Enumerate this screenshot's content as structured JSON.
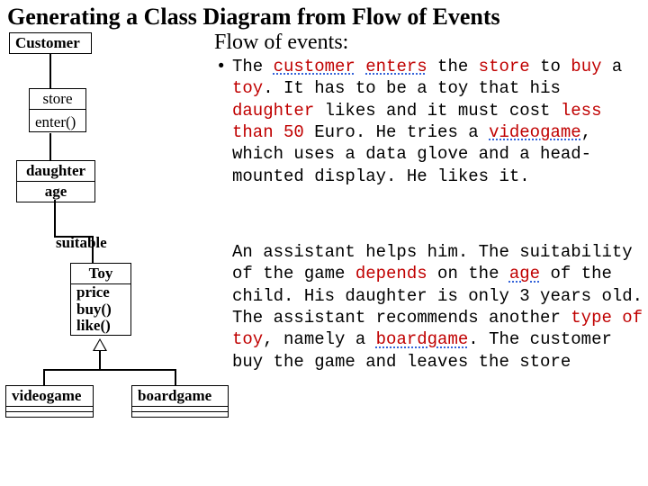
{
  "title": "Generating a Class Diagram from Flow of Events",
  "flow_header": "Flow of events:",
  "classes": {
    "customer": {
      "name": "Customer"
    },
    "store": {
      "name": "store",
      "ops": [
        "enter()"
      ]
    },
    "daughter": {
      "name": "daughter",
      "attrs": [
        "age"
      ]
    },
    "toy": {
      "name": "Toy",
      "attrs": [
        "price"
      ],
      "ops": [
        "buy()",
        "like()"
      ]
    },
    "videogame": {
      "name": "videogame"
    },
    "boardgame": {
      "name": "boardgame"
    }
  },
  "assoc_labels": {
    "customer_toy": "suitable"
  },
  "flow": {
    "p1_a": "The ",
    "p1_customer": "customer",
    "p1_b": " ",
    "p1_enters": "enters",
    "p1_c": " the ",
    "p1_store": "store",
    "p1_d": " to ",
    "p1_buy": "buy",
    "p1_e": " a ",
    "p1_toy": "toy",
    "p1_f": ". It has to be a toy that his ",
    "p1_daughter": "daughter",
    "p1_g": " likes and it must cost ",
    "p1_less": "less than 50",
    "p1_h": " Euro. He tries a ",
    "p1_videogame": "videogame",
    "p1_i": ", which uses a data glove and a head-mounted display. He likes it.",
    "p2_a": "An assistant helps him. The suitability of the game ",
    "p2_depends": "depends",
    "p2_b": " on the ",
    "p2_age": "age",
    "p2_c": " of the child. His daughter is only 3 years old. The assistant recommends another ",
    "p2_type": "type of toy",
    "p2_d": ", namely a ",
    "p2_boardgame": "boardgame",
    "p2_e": ". The customer buy the game and leaves the store"
  }
}
